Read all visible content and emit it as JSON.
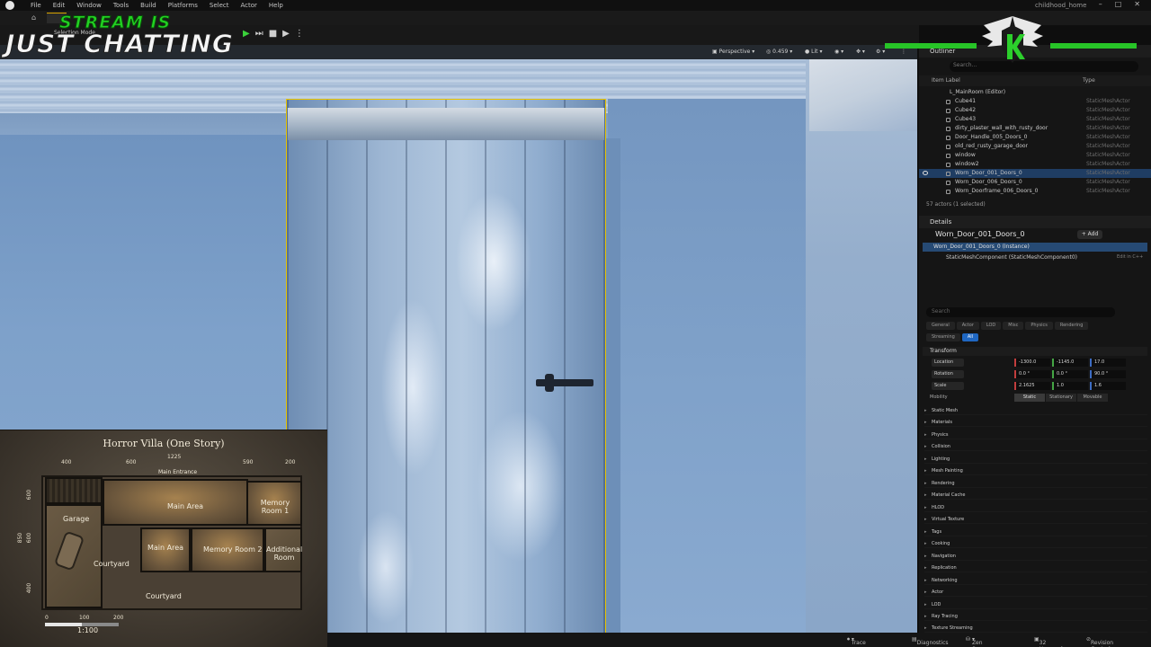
{
  "menu": [
    "File",
    "Edit",
    "Window",
    "Tools",
    "Build",
    "Platforms",
    "Select",
    "Actor",
    "Help"
  ],
  "project_name": "childhood_home",
  "toolbar": {
    "selection_mode": "Selection Mode"
  },
  "stream_overlay": {
    "line1": "STREAM IS",
    "line2": "JUST CHATTING"
  },
  "viewport": {
    "perspective": "Perspective",
    "speed": "0.459",
    "lit": "Lit",
    "selected_color": "#e8c400"
  },
  "outliner": {
    "tab": "Outliner",
    "search_placeholder": "Search...",
    "col_label": "Item Label",
    "col_type": "Type",
    "items": [
      {
        "name": "L_MainRoom (Editor)",
        "type": ""
      },
      {
        "name": "Cube41",
        "type": "StaticMeshActor"
      },
      {
        "name": "Cube42",
        "type": "StaticMeshActor"
      },
      {
        "name": "Cube43",
        "type": "StaticMeshActor"
      },
      {
        "name": "dirty_plaster_wall_with_rusty_door",
        "type": "StaticMeshActor"
      },
      {
        "name": "Door_Handle_005_Doors_0",
        "type": "StaticMeshActor"
      },
      {
        "name": "old_red_rusty_garage_door",
        "type": "StaticMeshActor"
      },
      {
        "name": "window",
        "type": "StaticMeshActor"
      },
      {
        "name": "window2",
        "type": "StaticMeshActor"
      },
      {
        "name": "Worn_Door_001_Doors_0",
        "type": "StaticMeshActor"
      },
      {
        "name": "Worn_Door_006_Doors_0",
        "type": "StaticMeshActor"
      },
      {
        "name": "Worn_Doorframe_006_Doors_0",
        "type": "StaticMeshActor"
      }
    ],
    "count": "57 actors (1 selected)"
  },
  "details": {
    "tab": "Details",
    "actor_name": "Worn_Door_001_Doors_0",
    "add_label": "+ Add",
    "instance": "Worn_Door_001_Doors_0 (Instance)",
    "component": "StaticMeshComponent (StaticMeshComponent0)",
    "edit_cpp": "Edit in C++",
    "search_placeholder": "Search",
    "filters": [
      "General",
      "Actor",
      "LOD",
      "Misc",
      "Physics",
      "Rendering",
      "Streaming",
      "All"
    ],
    "transform_label": "Transform",
    "location": {
      "label": "Location",
      "x": "-1300.0",
      "y": "-1145.0",
      "z": "17.0"
    },
    "rotation": {
      "label": "Rotation",
      "x": "0.0 °",
      "y": "0.0 °",
      "z": "90.0 °"
    },
    "scale": {
      "label": "Scale",
      "x": "2.1625",
      "y": "1.0",
      "z": "1.6"
    },
    "mobility_label": "Mobility",
    "mobility": [
      "Static",
      "Stationary",
      "Movable"
    ],
    "categories": [
      "Static Mesh",
      "Materials",
      "Physics",
      "Collision",
      "Lighting",
      "Mesh Painting",
      "Rendering",
      "Material Cache",
      "HLOD",
      "Virtual Texture",
      "Tags",
      "Cooking",
      "Navigation",
      "Replication",
      "Networking",
      "Actor",
      "LOD",
      "Ray Tracing",
      "Texture Streaming"
    ]
  },
  "map": {
    "title": "Horror Villa (One Story)",
    "dims_top": [
      "400",
      "1225",
      "600",
      "590",
      "200"
    ],
    "dims_left": [
      "600",
      "850",
      "600",
      "400"
    ],
    "rooms": {
      "main_entrance": "Main Entrance",
      "garage": "Garage",
      "main_area_top": "Main Area",
      "memory_room_1": "Memory Room 1",
      "main_area": "Main Area",
      "memory_room_2": "Memory Room 2",
      "additional_room": "Additional Room",
      "courtyard_left": "Courtyard",
      "courtyard_bottom": "Courtyard"
    },
    "scale_ticks": [
      "0",
      "100",
      "200"
    ],
    "scale_label": "1:100"
  },
  "status": {
    "trace": "Trace",
    "diagnostics": "Diagnostics",
    "zen": "Zen Server",
    "unsaved": "32 Unsaved",
    "revision": "Revision Control"
  },
  "colors": {
    "accent_green": "#27c427",
    "selection_blue": "#1f67c2"
  }
}
